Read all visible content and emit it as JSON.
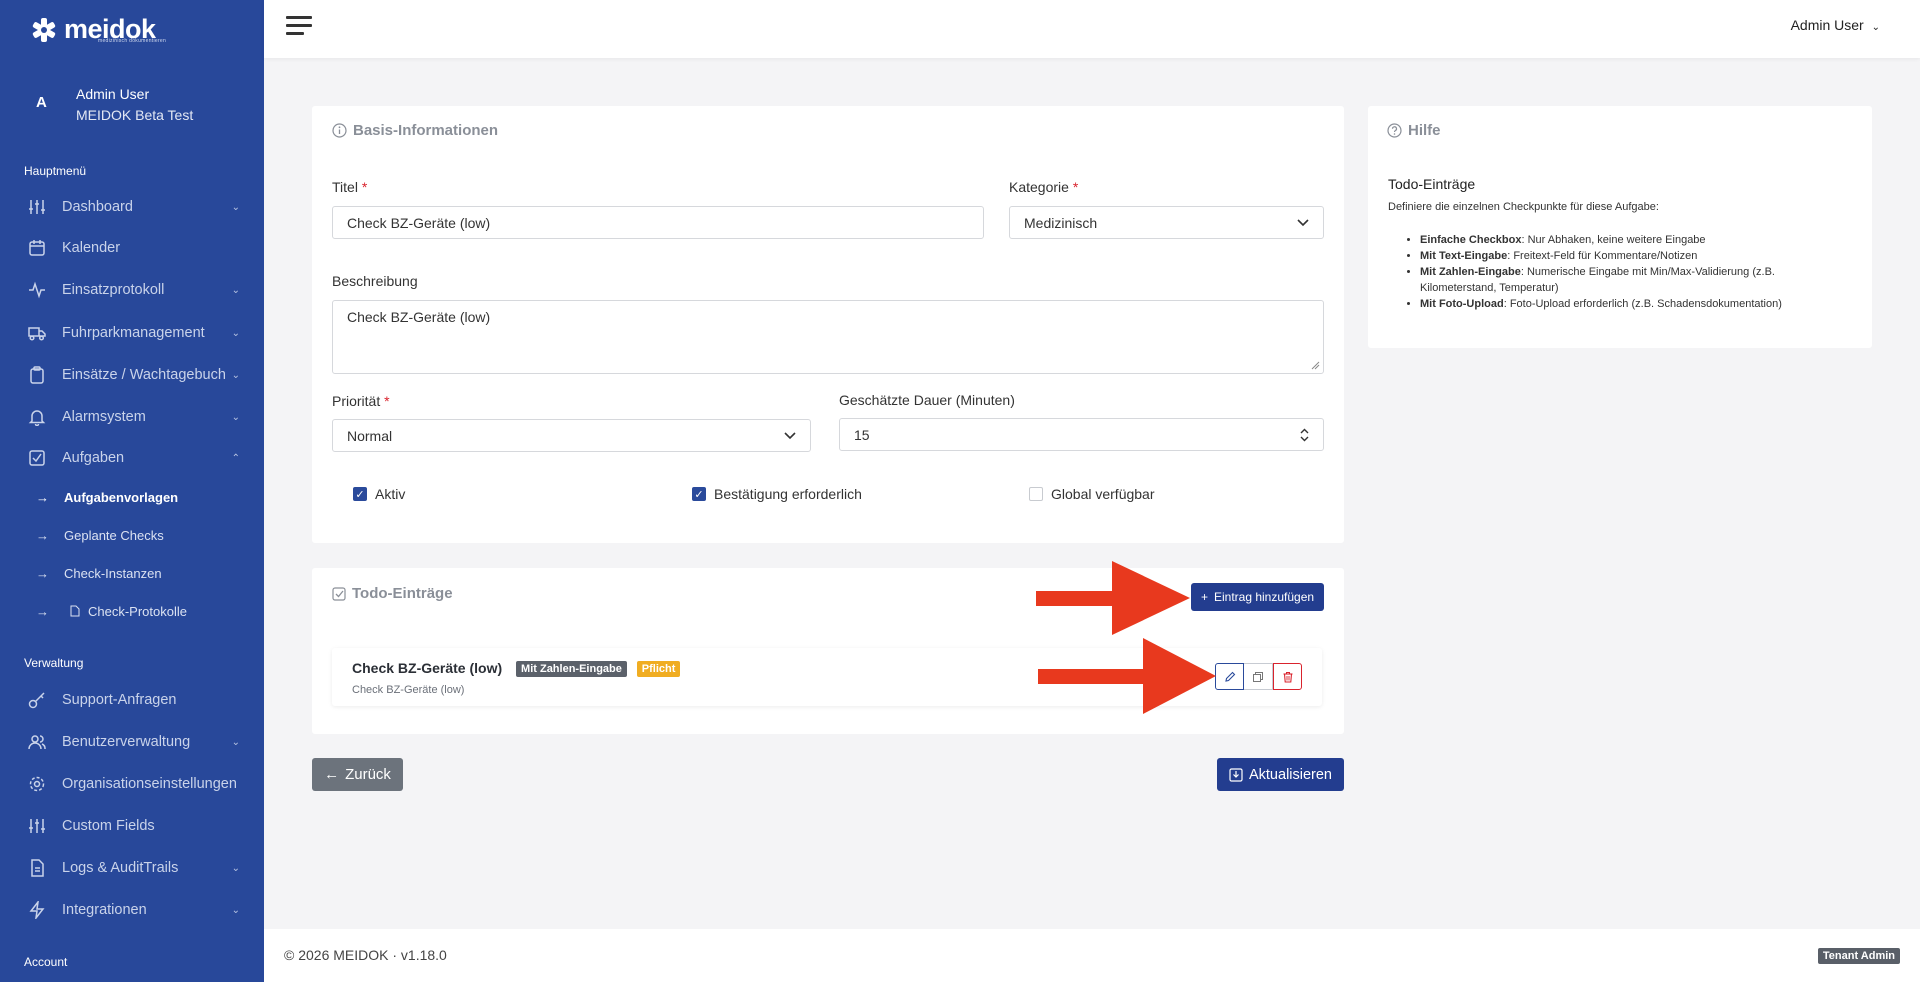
{
  "brand": {
    "name": "meidok",
    "subtitle": "medizinisch dokumentieren"
  },
  "user": {
    "initial": "A",
    "name": "Admin User",
    "org": "MEIDOK Beta Test"
  },
  "sidebar": {
    "main_title": "Hauptmenü",
    "main_items": [
      {
        "label": "Dashboard",
        "icon": "sliders-icon",
        "chevron": "⌄"
      },
      {
        "label": "Kalender",
        "icon": "calendar-icon",
        "chevron": ""
      },
      {
        "label": "Einsatzprotokoll",
        "icon": "activity-icon",
        "chevron": "⌄"
      },
      {
        "label": "Fuhrparkmanagement",
        "icon": "truck-icon",
        "chevron": "⌄"
      },
      {
        "label": "Einsätze / Wachtagebuch",
        "icon": "clipboard-icon",
        "chevron": "⌄"
      },
      {
        "label": "Alarmsystem",
        "icon": "bell-icon",
        "chevron": "⌄"
      },
      {
        "label": "Aufgaben",
        "icon": "check-square-icon",
        "chevron": "⌃"
      }
    ],
    "sub_items": [
      {
        "label": "Aufgabenvorlagen",
        "arrow": "→"
      },
      {
        "label": "Geplante Checks",
        "arrow": "→"
      },
      {
        "label": "Check-Instanzen",
        "arrow": "→"
      },
      {
        "label": "Check-Protokolle",
        "arrow": "→"
      }
    ],
    "admin_title": "Verwaltung",
    "admin_items": [
      {
        "label": "Support-Anfragen",
        "icon": "key-icon",
        "chevron": ""
      },
      {
        "label": "Benutzerverwaltung",
        "icon": "users-icon",
        "chevron": "⌄"
      },
      {
        "label": "Organisationseinstellungen",
        "icon": "gear-icon",
        "chevron": ""
      },
      {
        "label": "Custom Fields",
        "icon": "sliders-icon",
        "chevron": ""
      },
      {
        "label": "Logs & AuditTrails",
        "icon": "file-icon",
        "chevron": "⌄"
      },
      {
        "label": "Integrationen",
        "icon": "zap-icon",
        "chevron": "⌄"
      }
    ],
    "account_label": "Account"
  },
  "topbar": {
    "user_label": "Admin User",
    "user_chevron": "⌄"
  },
  "basis": {
    "title": "Basis-Informationen",
    "titel_label": "Titel",
    "titel_value": "Check BZ-Geräte (low)",
    "kategorie_label": "Kategorie",
    "kategorie_value": "Medizinisch",
    "beschreibung_label": "Beschreibung",
    "beschreibung_value": "Check BZ-Geräte (low)",
    "prioritaet_label": "Priorität",
    "prioritaet_value": "Normal",
    "dauer_label": "Geschätzte Dauer (Minuten)",
    "dauer_value": "15",
    "required_mark": "*",
    "checkboxes": [
      {
        "label": "Aktiv",
        "checked": true
      },
      {
        "label": "Bestätigung erforderlich",
        "checked": true
      },
      {
        "label": "Global verfügbar",
        "checked": false
      }
    ]
  },
  "todo": {
    "title": "Todo-Einträge",
    "add_button": "Eintrag hinzufügen",
    "add_icon": "+",
    "item": {
      "title": "Check BZ-Geräte (low)",
      "type_badge": "Mit Zahlen-Eingabe",
      "required_badge": "Pflicht",
      "description": "Check BZ-Geräte (low)"
    }
  },
  "actions": {
    "back_label": "Zurück",
    "update_label": "Aktualisieren"
  },
  "help": {
    "title": "Hilfe",
    "heading": "Todo-Einträge",
    "intro": "Definiere die einzelnen Checkpunkte für diese Aufgabe:",
    "items": [
      {
        "term": "Einfache Checkbox",
        "text": ": Nur Abhaken, keine weitere Eingabe"
      },
      {
        "term": "Mit Text-Eingabe",
        "text": ": Freitext-Feld für Kommentare/Notizen"
      },
      {
        "term": "Mit Zahlen-Eingabe",
        "text": ": Numerische Eingabe mit Min/Max-Validierung (z.B. Kilometerstand, Temperatur)"
      },
      {
        "term": "Mit Foto-Upload",
        "text": ": Foto-Upload erforderlich (z.B. Schadensdokumentation)"
      }
    ]
  },
  "footer": {
    "copyright": "© 2026 MEIDOK · v1.18.0",
    "tenant_badge": "Tenant Admin"
  },
  "colors": {
    "sidebar": "#28489a",
    "primary": "#233d8f",
    "danger": "#d9232d",
    "warning_badge": "#f0ad22",
    "annotation_arrow": "#e8391e"
  }
}
